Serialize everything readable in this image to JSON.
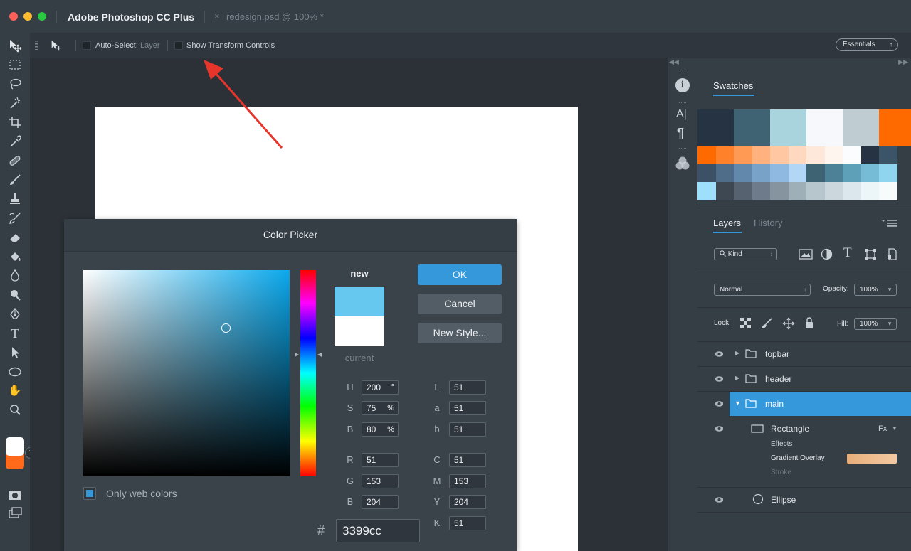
{
  "titlebar": {
    "app_title": "Adobe Photoshop CC Plus",
    "doc_tab": "redesign.psd @ 100% *",
    "close_glyph": "×",
    "traffic_colors": [
      "#fe5f57",
      "#febc2e",
      "#28c840"
    ]
  },
  "options": {
    "auto_select_label": "Auto-Select:",
    "auto_select_value": "Layer",
    "show_transform_label": "Show Transform Controls",
    "workspace": "Essentials"
  },
  "tools": [
    "move-icon",
    "marquee-icon",
    "lasso-icon",
    "magic-wand-icon",
    "crop-icon",
    "eyedropper-icon",
    "healing-icon",
    "brush-icon",
    "stamp-icon",
    "history-brush-icon",
    "eraser-icon",
    "bucket-icon",
    "blur-icon",
    "dodge-icon",
    "pen-icon",
    "type-icon",
    "path-select-icon",
    "ellipse-icon",
    "hand-icon",
    "zoom-icon"
  ],
  "tool_glyphs": {
    "type": "T",
    "ellipse": "◯",
    "hand": "✋",
    "zoom": "⚲"
  },
  "colors": {
    "foreground": "#ffffff",
    "background": "#ff6a1a",
    "accent": "#3498db",
    "arrow": "#e8352b"
  },
  "side_icons": {
    "info": "i",
    "type": "A|",
    "paragraph": "¶"
  },
  "swatches": {
    "tab_label": "Swatches",
    "big_row": [
      "#253342",
      "#3f6373",
      "#aad4dd",
      "#f6f8fc",
      "#bfcdd3",
      "#ff6a00"
    ],
    "row2": [
      "#ff6a00",
      "#ff822a",
      "#ff9a55",
      "#ffb27d",
      "#ffc8a3",
      "#ffd8c0",
      "#fde8da",
      "#fef5ef",
      "#fbfcfe",
      "#253342",
      "#3b5468"
    ],
    "row3": [
      "#3c5166",
      "#4f6d89",
      "#6288ab",
      "#79a2c8",
      "#8fb9e0",
      "#b1d6f6",
      "#3e6373",
      "#4c8197",
      "#5ea0b8",
      "#76bcd6",
      "#8fd5ef"
    ],
    "row4": [
      "#9ee0fb",
      "#3d4853",
      "#566270",
      "#6d7b8a",
      "#85949f",
      "#9fafb8",
      "#b7c5cc",
      "#cbd7dc",
      "#dbe7ec",
      "#ecf5f8",
      "#f8fbfc"
    ]
  },
  "layers_panel": {
    "tabs": [
      "Layers",
      "History"
    ],
    "kind_label": "Kind",
    "blend_mode": "Normal",
    "opacity_label": "Opacity:",
    "opacity_value": "100%",
    "lock_label": "Lock:",
    "fill_label": "Fill:",
    "fill_value": "100%",
    "layers": [
      {
        "name": "topbar",
        "type": "folder",
        "expanded": false,
        "selected": false
      },
      {
        "name": "header",
        "type": "folder",
        "expanded": false,
        "selected": false
      },
      {
        "name": "main",
        "type": "folder",
        "expanded": true,
        "selected": true
      },
      {
        "name": "Rectangle",
        "type": "shape",
        "fx": "Fx"
      },
      {
        "name": "Ellipse",
        "type": "ellipse"
      }
    ],
    "effects_label": "Effects",
    "gradient_overlay": "Gradient Overlay",
    "stroke_label": "Stroke",
    "gradient_colors": [
      "#e8ae7a",
      "#f3c9a3"
    ]
  },
  "picker": {
    "title": "Color Picker",
    "new_label": "new",
    "current_label": "current",
    "new_color": "#66c8ee",
    "current_color": "#ffffff",
    "field_hue": "#0aa8ec",
    "ok": "OK",
    "cancel": "Cancel",
    "new_style": "New Style...",
    "only_web": "Only web colors",
    "hash": "#",
    "hex": "3399cc",
    "hsb": [
      {
        "label": "H",
        "value": "200",
        "unit": "°"
      },
      {
        "label": "S",
        "value": "75",
        "unit": "%"
      },
      {
        "label": "B",
        "value": "80",
        "unit": "%"
      }
    ],
    "rgb": [
      {
        "label": "R",
        "value": "51"
      },
      {
        "label": "G",
        "value": "153"
      },
      {
        "label": "B",
        "value": "204"
      }
    ],
    "lab": [
      {
        "label": "L",
        "value": "51"
      },
      {
        "label": "a",
        "value": "51"
      },
      {
        "label": "b",
        "value": "51"
      }
    ],
    "cmyk": [
      {
        "label": "C",
        "value": "51"
      },
      {
        "label": "M",
        "value": "153"
      },
      {
        "label": "Y",
        "value": "204"
      },
      {
        "label": "K",
        "value": "51"
      }
    ]
  }
}
